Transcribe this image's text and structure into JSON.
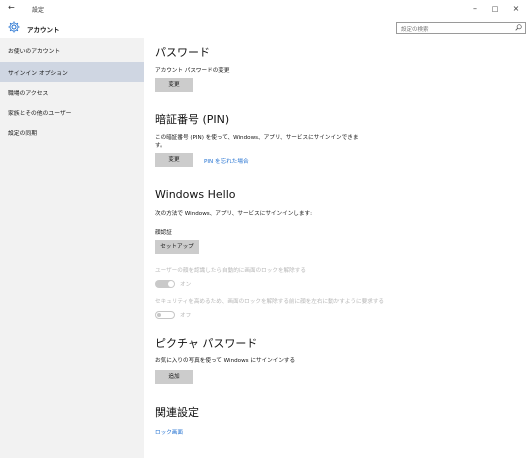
{
  "window": {
    "back_glyph": "←",
    "title": "設定",
    "min_glyph": "–",
    "max_glyph": "□",
    "close_glyph": "×"
  },
  "header": {
    "icon": "gear-icon",
    "title": "アカウント"
  },
  "search": {
    "placeholder": "設定の検索",
    "icon": "search-icon"
  },
  "sidebar": {
    "items": [
      {
        "label": "お使いのアカウント",
        "active": false
      },
      {
        "label": "サインイン オプション",
        "active": true
      },
      {
        "label": "職場のアクセス",
        "active": false
      },
      {
        "label": "家族とその他のユーザー",
        "active": false
      },
      {
        "label": "設定の同期",
        "active": false
      }
    ]
  },
  "password": {
    "title": "パスワード",
    "desc": "アカウント パスワードの変更",
    "button": "変更"
  },
  "pin": {
    "title": "暗証番号 (PIN)",
    "desc_line1": "この暗証番号 (PIN) を使って、Windows、アプリ、サービスにサインインできま",
    "desc_line2": "す。",
    "button": "変更",
    "forgot_link": "PIN を忘れた場合"
  },
  "hello": {
    "title": "Windows Hello",
    "desc": "次の方法で Windows、アプリ、サービスにサインインします:",
    "face_label": "顔認証",
    "setup_button": "セットアップ",
    "option1_label": "ユーザーの顔を認識したら自動的に画面のロックを解除する",
    "option1_state": "オン",
    "option2_label": "セキュリティを高めるため、画面のロックを解除する前に顔を左右に動かすように要求する",
    "option2_state": "オフ"
  },
  "picture": {
    "title": "ピクチャ パスワード",
    "desc": "お気に入りの写真を使って Windows にサインインする",
    "button": "追加"
  },
  "related": {
    "title": "関連設定",
    "link": "ロック画面"
  }
}
